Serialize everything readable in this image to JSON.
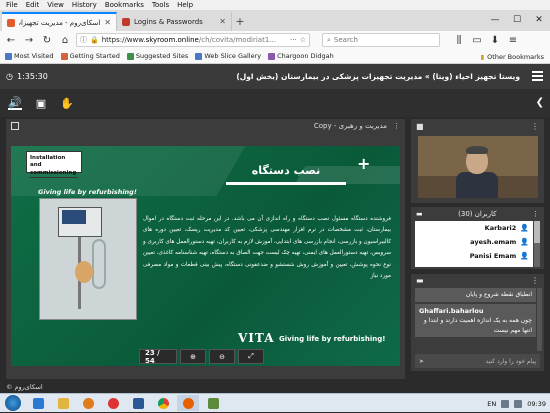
{
  "menu": [
    "File",
    "Edit",
    "View",
    "History",
    "Bookmarks",
    "Tools",
    "Help"
  ],
  "tabs": [
    {
      "label": "اسکای‌روم - مدیریت تجهیزات پز",
      "favicon_color": "#e05a2b",
      "active": true
    },
    {
      "label": "Logins & Passwords",
      "favicon_color": "#c0392b",
      "active": false
    }
  ],
  "window_controls": {
    "minimize": "—",
    "maximize": "☐",
    "close": "✕"
  },
  "nav": {
    "back": "←",
    "forward": "→",
    "reload": "↻",
    "home": "⌂",
    "url_scheme": "https://www.",
    "url_host": "skyroom.online",
    "url_path": "/ch/covita/modiriat1...",
    "search_placeholder": "Search",
    "menu_icon": "≡"
  },
  "bookmarks": [
    {
      "label": "Most Visited",
      "color": "#4a78c2"
    },
    {
      "label": "Getting Started",
      "color": "#d1643a"
    },
    {
      "label": "Suggested Sites",
      "color": "#3d8f4a"
    },
    {
      "label": "Web Slice Gallery",
      "color": "#4a78c2"
    },
    {
      "label": "Chargoon Didgah",
      "color": "#8a5aa8"
    }
  ],
  "other_bookmarks": "Other Bookmarks",
  "header": {
    "timer": "1:35:30",
    "room_title": "ویستا تجهیز احیاء (ویتا) » مدیریت تجهیزات پزشکی در بیمارستان (بخش اول)"
  },
  "presentation": {
    "title": "مدیریت و رهبری - Copy",
    "slide": {
      "box_line1": "Installation and",
      "box_line2": "commissioning",
      "heading": "نصب دستگاه",
      "tagline": "Giving life by refurbishing!",
      "body": "فروشنده دستگاه مسئول نصب دستگاه و راه اندازی آن می باشد. در این مرحله ثبت دستگاه در اموال بیمارستان، ثبت مشخصات در نرم افزار مهندسی پزشکی، تعیین کد مدیریت ریسک، تعیین دوره های کالیبراسیون و بازرسی، انجام بازرسی های ابتدایی، آموزش لازم به کاربران، تهیه دستورالعمل های کاربری و سرویس، تهیه دستورالعمل های ایمنی، تهیه چک لیست جهت الصاق به دستگاه، تهیه شناسنامه کاغذی، تعیین نوع نحوه پوشش، تعیین و آموزش روش شستشو و ضدعفونی دستگاه، پیش بینی قطعات و مواد مصرفی مورد نیاز",
      "footer_logo": "VITA",
      "footer_text": "Giving life by refurbishing!"
    },
    "page_counter": "23 / 54",
    "zoom_in": "⊕",
    "zoom_out": "⊖",
    "fit": "⤢"
  },
  "users": {
    "title": "کاربران (30)",
    "list": [
      "Karbari2",
      "ayesh.emam",
      "Panisi Emam"
    ]
  },
  "chat": {
    "messages": [
      {
        "name": "",
        "text": "انطباق نقطه شروع و پایان"
      },
      {
        "name": "Ghaffari.baharlou",
        "text": "چون همه به یک اندازه اهمیت دارند و ابتدا و انتها مهم نیست"
      }
    ],
    "input_placeholder": "پیام خود را وارد کنید"
  },
  "footer_brand": "اسکای‌روم",
  "tray": {
    "lang": "EN",
    "time": "09:39"
  }
}
